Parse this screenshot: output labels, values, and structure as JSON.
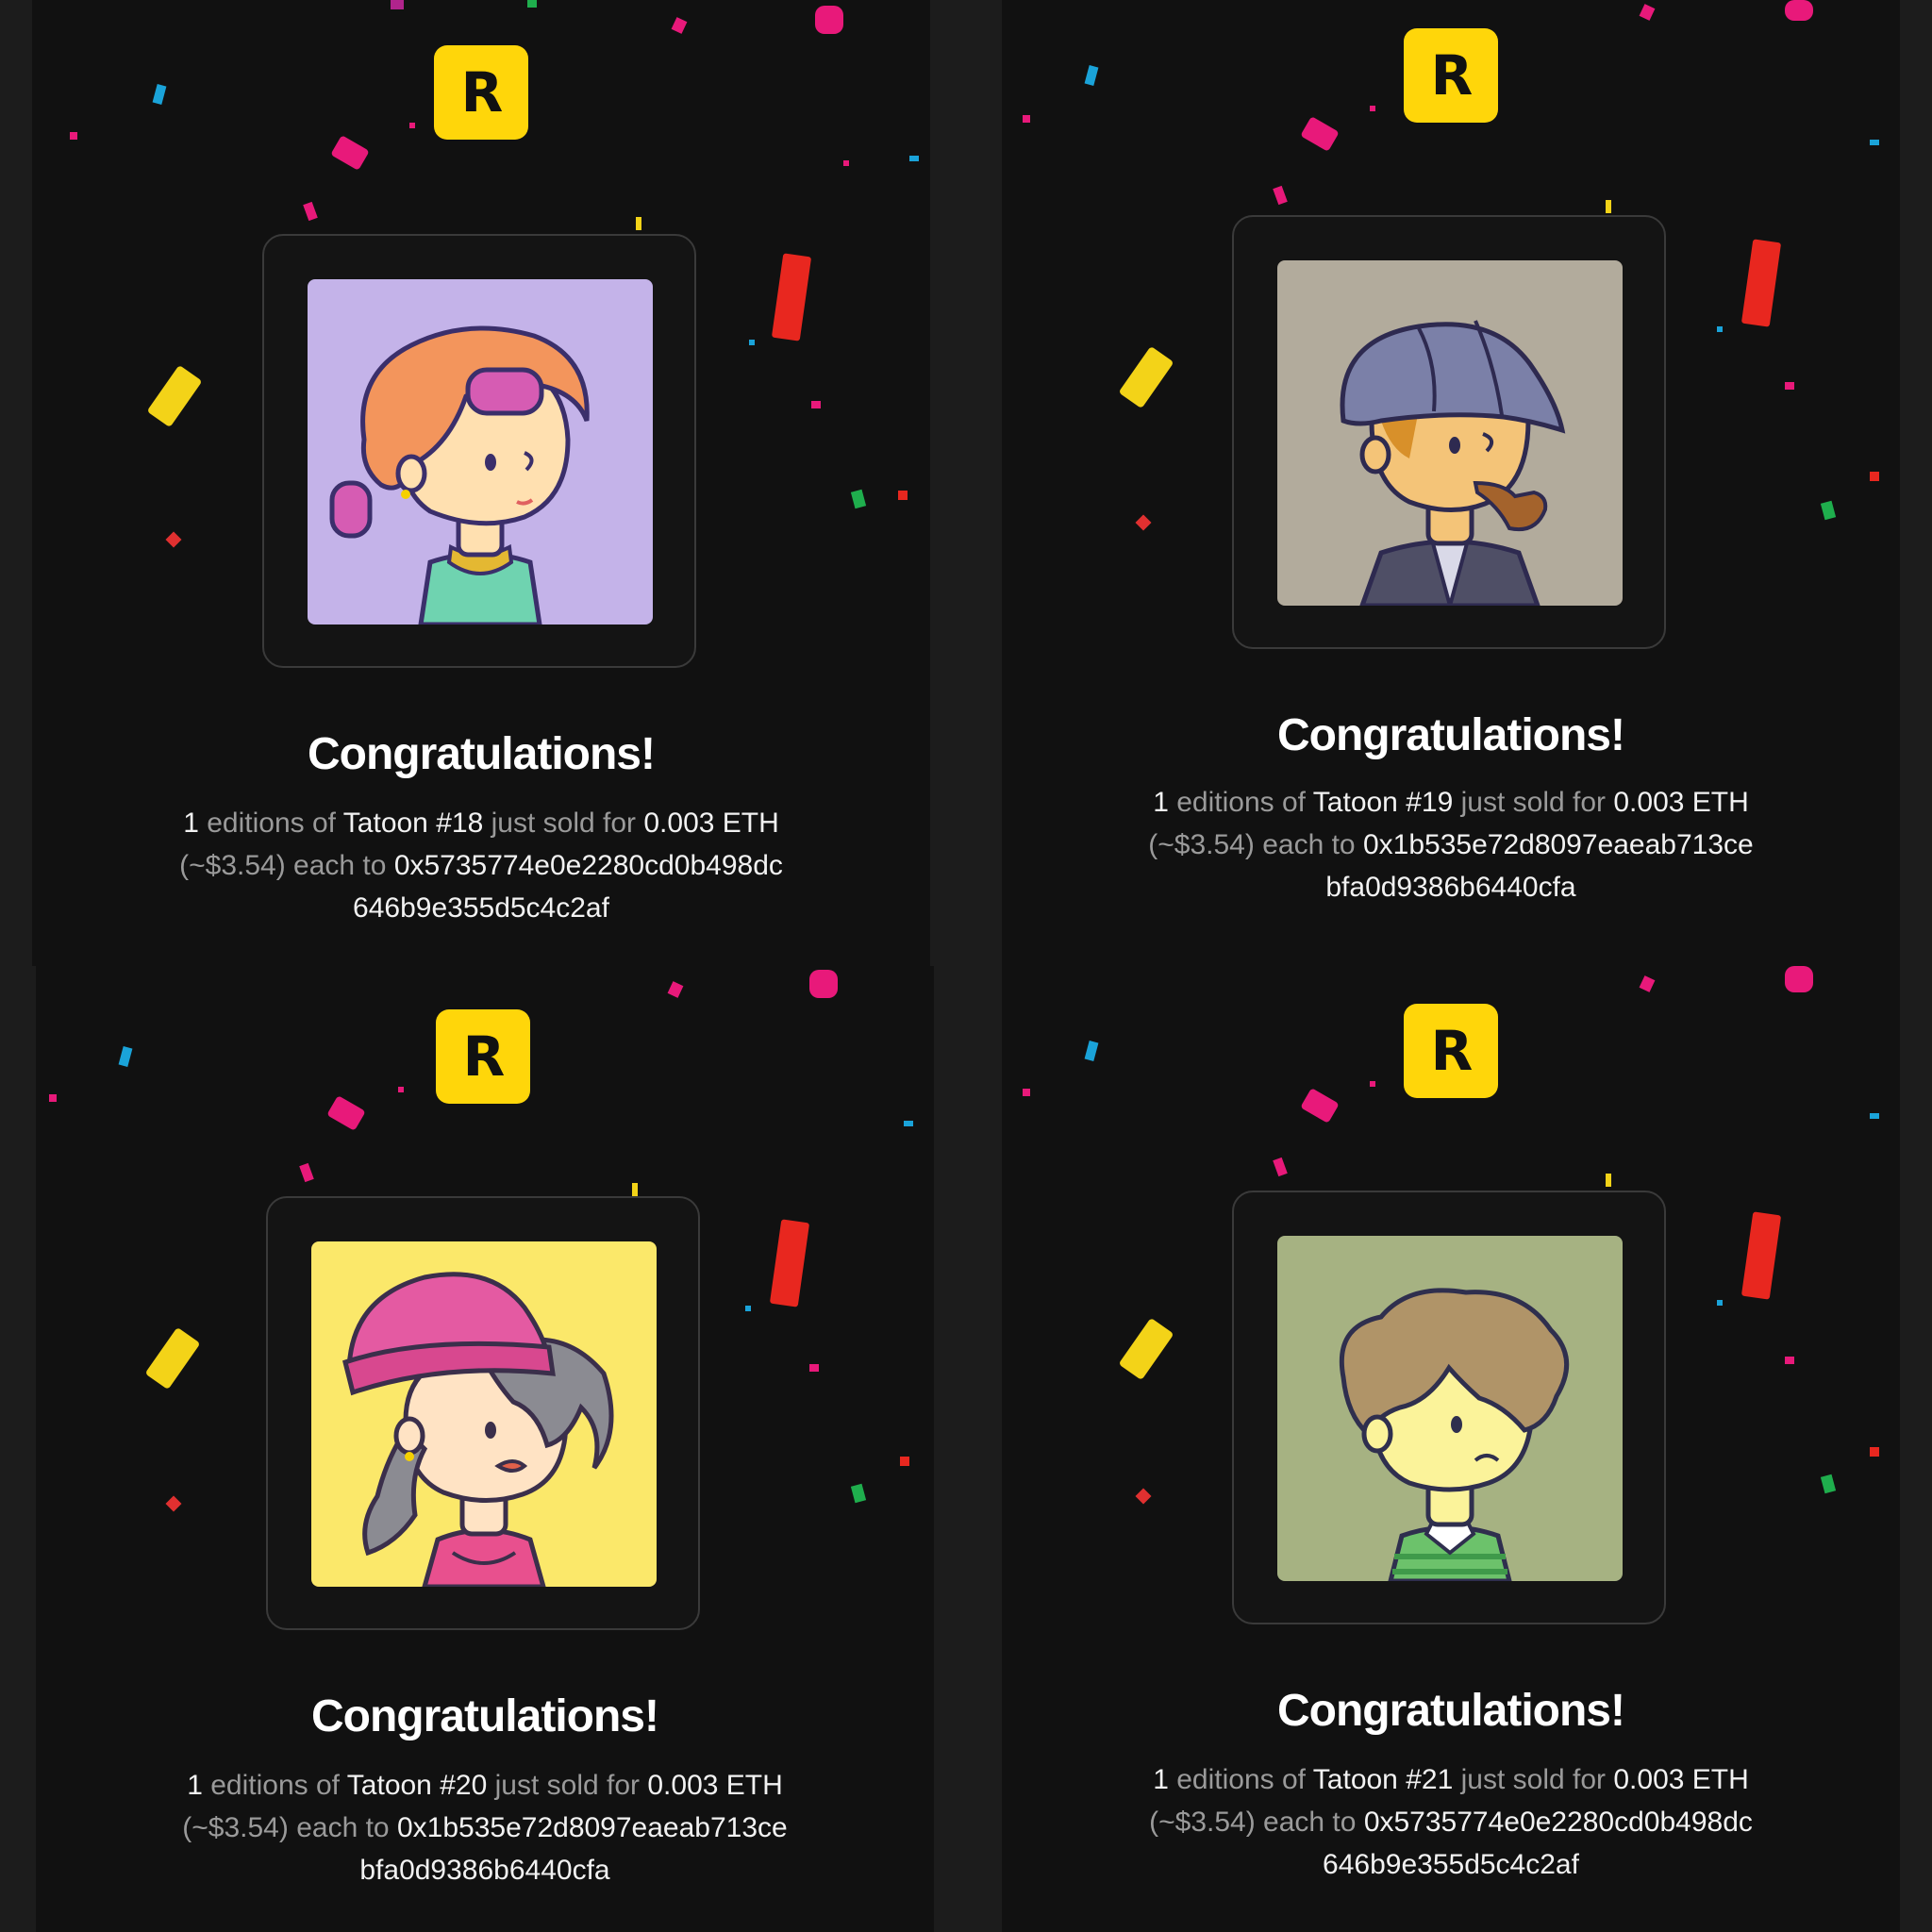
{
  "colors": {
    "brand": "#ffd60a",
    "background": "#111111"
  },
  "cards": [
    {
      "logo_text": "R",
      "artwork": "tatoon-girl-with-hair-rollers",
      "artwork_bg": "#c4b3e9",
      "title": "Congratulations!",
      "qty": "1",
      "t_editions": "editions of",
      "item": "Tatoon #18",
      "t_sold": "just sold for",
      "price_amount": "0.003",
      "price_currency": "ETH",
      "usd": "(~$3.54)",
      "t_each": "each to",
      "address": "0x5735774e0e2280cd0b498dc646b9e355d5c4c2af"
    },
    {
      "logo_text": "R",
      "artwork": "tatoon-boy-with-cap-and-pipe",
      "artwork_bg": "#b2ab9c",
      "title": "Congratulations!",
      "qty": "1",
      "t_editions": "editions of",
      "item": "Tatoon #19",
      "t_sold": "just sold for",
      "price_amount": "0.003",
      "price_currency": "ETH",
      "usd": "(~$3.54)",
      "t_each": "each to",
      "address": "0x1b535e72d8097eaeab713cebfa0d9386b6440cfa"
    },
    {
      "logo_text": "R",
      "artwork": "tatoon-girl-with-pink-beanie",
      "artwork_bg": "#fbe86a",
      "title": "Congratulations!",
      "qty": "1",
      "t_editions": "editions of",
      "item": "Tatoon #20",
      "t_sold": "just sold for",
      "price_amount": "0.003",
      "price_currency": "ETH",
      "usd": "(~$3.54)",
      "t_each": "each to",
      "address": "0x1b535e72d8097eaeab713cebfa0d9386b6440cfa"
    },
    {
      "logo_text": "R",
      "artwork": "tatoon-boy-with-brown-hair",
      "artwork_bg": "#a6b282",
      "title": "Congratulations!",
      "qty": "1",
      "t_editions": "editions of",
      "item": "Tatoon #21",
      "t_sold": "just sold for",
      "price_amount": "0.003",
      "price_currency": "ETH",
      "usd": "(~$3.54)",
      "t_each": "each to",
      "address": "0x5735774e0e2280cd0b498dc646b9e355d5c4c2af"
    }
  ]
}
